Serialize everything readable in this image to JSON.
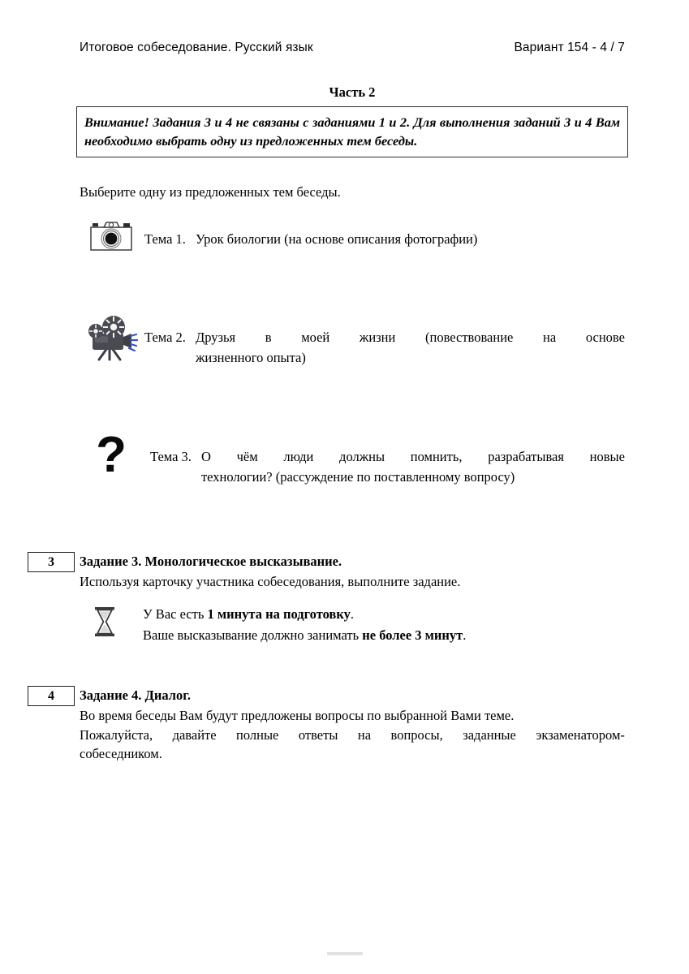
{
  "header": {
    "left_text": "Итоговое собеседование. Русский язык",
    "right_text": "Вариант 154 - 4 / 7"
  },
  "part": {
    "title": "Часть 2"
  },
  "attention": {
    "text": "Внимание! Задания 3 и 4 не связаны с заданиями 1 и 2. Для выполнения заданий 3 и 4 Вам необходимо выбрать одну из предложенных тем беседы."
  },
  "lead_instruction": "Выберите одну из предложенных тем беседы.",
  "themes": [
    {
      "icon": "camera-icon",
      "label": "Тема 1.",
      "text": "Урок биологии (на основе описания фотографии)"
    },
    {
      "icon": "film-projector-icon",
      "label": "Тема 2.",
      "line1": "Друзья в моей жизни (повествование на основе",
      "line2": "жизненного опыта)",
      "text": "Друзья в моей жизни (повествование на основе жизненного опыта)"
    },
    {
      "icon": "question-mark-icon",
      "label": "Тема 3.",
      "line1": "О чём люди должны помнить, разрабатывая новые",
      "line2": "технологии? (рассуждение по поставленному вопросу)",
      "text": "О чём люди должны помнить, разрабатывая новые технологии? (рассуждение по поставленному вопросу)"
    }
  ],
  "task3": {
    "number": "3",
    "heading": "Задание 3. Монологическое высказывание.",
    "instruction": "Используя карточку участника собеседования, выполните задание.",
    "timing": {
      "icon": "hourglass-icon",
      "line1_plain_before": "У Вас есть ",
      "line1_bold": "1 минута на подготовку",
      "line1_plain_after": ".",
      "line2_plain_before": "Ваше высказывание должно занимать ",
      "line2_bold": "не более 3 минут",
      "line2_plain_after": "."
    }
  },
  "task4": {
    "number": "4",
    "heading": "Задание 4. Диалог.",
    "para_line1": "Во время беседы Вам будут предложены вопросы по выбранной Вами теме.",
    "para_line2": "Пожалуйста, давайте полные ответы на вопросы, заданные экзаменатором-",
    "para_line3": "собеседником.",
    "paragraph": "Во время беседы Вам будут предложены вопросы по выбранной Вами теме. Пожалуйста, давайте полные ответы на вопросы, заданные экзаменатором-собеседником."
  },
  "colors": {
    "text": "#000000",
    "box_border": "#2b2b2b",
    "projector_body": "#4a4a52",
    "projector_rays": "#3b52c4"
  }
}
